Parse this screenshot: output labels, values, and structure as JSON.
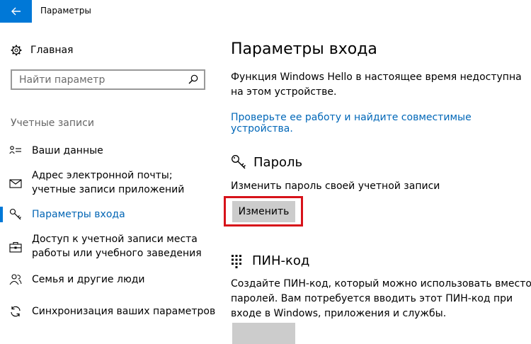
{
  "window": {
    "title": "Параметры"
  },
  "sidebar": {
    "home_label": "Главная",
    "search_placeholder": "Найти параметр",
    "section_label": "Учетные записи",
    "items": [
      {
        "label": "Ваши данные",
        "icon": "person-list-icon"
      },
      {
        "label": "Адрес электронной почты; учетные записи приложений",
        "icon": "mail-icon"
      },
      {
        "label": "Параметры входа",
        "icon": "key-icon",
        "active": true
      },
      {
        "label": "Доступ к учетной записи места работы или учебного заведения",
        "icon": "briefcase-icon"
      },
      {
        "label": "Семья и другие люди",
        "icon": "people-icon"
      },
      {
        "label": "Синхронизация ваших параметров",
        "icon": "sync-icon"
      }
    ]
  },
  "main": {
    "title": "Параметры входа",
    "hello_text": "Функция Windows Hello в настоящее время недоступна на этом устройстве.",
    "hello_link": "Проверьте ее работу и найдите совместимые устройства.",
    "password": {
      "title": "Пароль",
      "description": "Изменить пароль своей учетной записи",
      "button_label": "Изменить"
    },
    "pin": {
      "title": "ПИН-код",
      "description": "Создайте ПИН-код, который можно использовать вместо паролей. Вам потребуется вводить этот ПИН-код при входе в Windows, приложения и службы."
    }
  },
  "colors": {
    "accent": "#0078d7",
    "link": "#0067b8",
    "highlight": "#d7121a",
    "button": "#cccccc"
  }
}
